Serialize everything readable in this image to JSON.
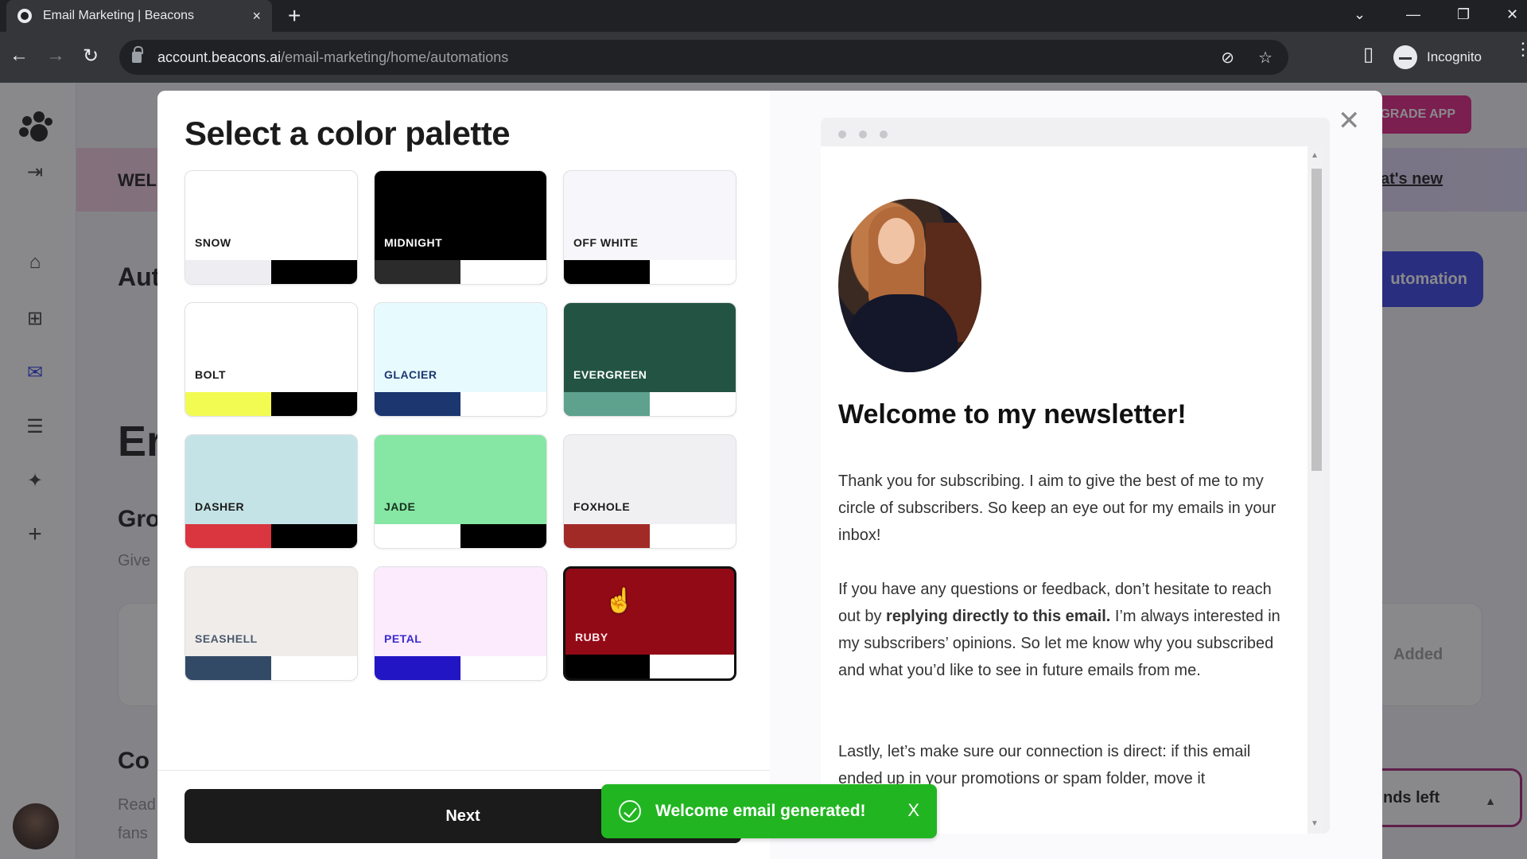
{
  "browser": {
    "tab_title": "Email Marketing | Beacons",
    "tab_close": "×",
    "new_tab": "+",
    "url_host": "account.beacons.ai",
    "url_path": "/email-marketing/home/automations",
    "profile_label": "Incognito",
    "window_controls": {
      "dropdown": "⌄",
      "minimize": "—",
      "restore": "❐",
      "close": "✕"
    },
    "nav": {
      "back": "←",
      "forward": "→",
      "reload": "↻"
    },
    "omni_icons": {
      "eye_off": "⊘",
      "star": "☆",
      "sidepanel": "▯"
    }
  },
  "app": {
    "banner_prefix": "WEL",
    "banner_link": "at's new",
    "banner_chevron": "›",
    "upgrade_label": "GRADE APP",
    "heading_automations": "Aut",
    "new_automation_label": "utomation",
    "heading_email": "Er",
    "heading_grow": "Gro",
    "text_give": "Give",
    "added_label": "Added",
    "heading_connect": "Co",
    "text_read": "Read",
    "text_fans": "fans",
    "sends_left_label": "nds left",
    "sends_caret": "▲",
    "sidebar_icons": {
      "menu": "⇥",
      "home": "⌂",
      "apps": "⊞",
      "mail": "✉",
      "store": "☰",
      "social": "✦",
      "add": "+"
    }
  },
  "modal": {
    "title": "Select a color palette",
    "close": "✕",
    "next_label": "Next",
    "selected_palette": "RUBY",
    "palettes": [
      {
        "name": "SNOW",
        "bg": "#ffffff",
        "label_color": "#1b1b1b",
        "swatch1": "#eeeef2",
        "swatch2": "#000000"
      },
      {
        "name": "MIDNIGHT",
        "bg": "#000000",
        "label_color": "#ffffff",
        "swatch1": "#2b2b2b",
        "swatch2": "#ffffff"
      },
      {
        "name": "OFF WHITE",
        "bg": "#f7f6fa",
        "label_color": "#1b1b1b",
        "swatch1": "#000000",
        "swatch2": "#ffffff"
      },
      {
        "name": "BOLT",
        "bg": "#ffffff",
        "label_color": "#1b1b1b",
        "swatch1": "#f2fb52",
        "swatch2": "#000000"
      },
      {
        "name": "GLACIER",
        "bg": "#e7fbfe",
        "label_color": "#1c3670",
        "swatch1": "#1c3670",
        "swatch2": "#ffffff"
      },
      {
        "name": "EVERGREEN",
        "bg": "#235443",
        "label_color": "#ffffff",
        "swatch1": "#5ea28e",
        "swatch2": "#ffffff"
      },
      {
        "name": "DASHER",
        "bg": "#c4e3e6",
        "label_color": "#1b1b1b",
        "swatch1": "#d9363f",
        "swatch2": "#000000"
      },
      {
        "name": "JADE",
        "bg": "#86e6a3",
        "label_color": "#15301d",
        "swatch1": "#ffffff",
        "swatch2": "#000000"
      },
      {
        "name": "FOXHOLE",
        "bg": "#f0eff2",
        "label_color": "#1b1b1b",
        "swatch1": "#a12a27",
        "swatch2": "#ffffff"
      },
      {
        "name": "SEASHELL",
        "bg": "#f0ecea",
        "label_color": "#4a5a6e",
        "swatch1": "#334a66",
        "swatch2": "#ffffff"
      },
      {
        "name": "PETAL",
        "bg": "#fcebfd",
        "label_color": "#3a2ad0",
        "swatch1": "#2216c4",
        "swatch2": "#ffffff"
      },
      {
        "name": "RUBY",
        "bg": "#920a16",
        "label_color": "#ffe9ec",
        "swatch1": "#000000",
        "swatch2": "#ffffff"
      }
    ]
  },
  "preview": {
    "heading": "Welcome to my newsletter!",
    "p1": "Thank you for subscribing. I aim to give the best of me to my circle of subscribers. So keep an eye out for my emails in your inbox!",
    "p2_before": "If you have any questions or feedback, don’t hesitate to reach out by ",
    "p2_bold": "replying directly to this email.",
    "p2_after": " I’m always interested in my subscribers’ opinions. So let me know why you subscribed and what you’d like to see in future emails from me.",
    "p3": "Lastly, let’s make sure our connection is direct: if this email ended up in your promotions or spam folder, move it",
    "scroll_up": "▲",
    "scroll_down": "▼"
  },
  "toast": {
    "message": "Welcome email generated!",
    "close": "X",
    "color": "#22b522"
  }
}
